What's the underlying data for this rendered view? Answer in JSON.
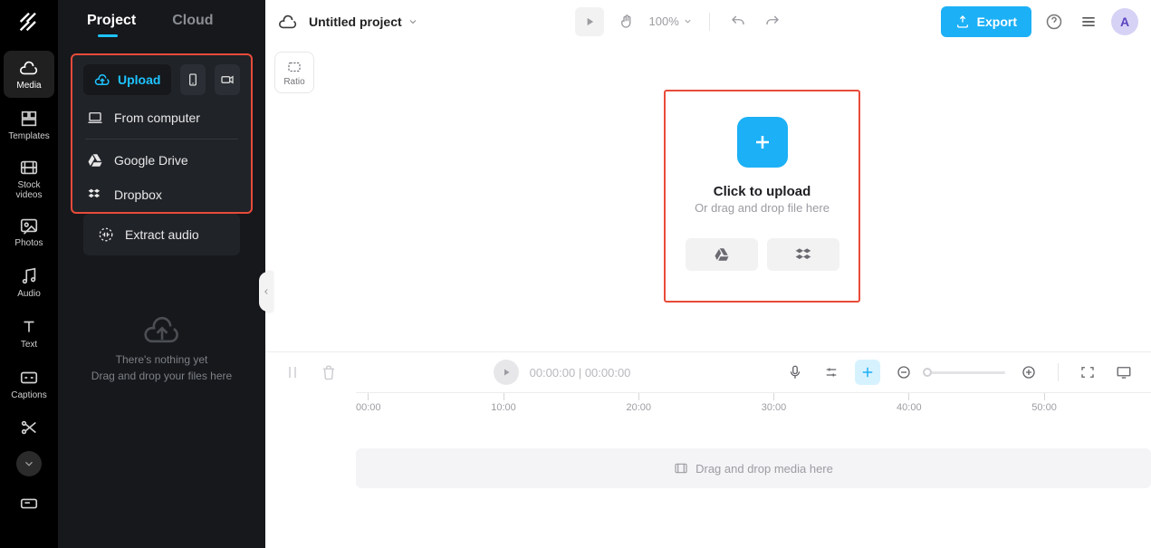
{
  "header": {
    "project_title": "Untitled project",
    "zoom": "100%",
    "export_label": "Export",
    "avatar_letter": "A"
  },
  "rail": {
    "items": [
      {
        "label": "Media"
      },
      {
        "label": "Templates"
      },
      {
        "label": "Stock videos"
      },
      {
        "label": "Photos"
      },
      {
        "label": "Audio"
      },
      {
        "label": "Text"
      },
      {
        "label": "Captions"
      }
    ]
  },
  "panel": {
    "tabs": {
      "project": "Project",
      "cloud": "Cloud"
    },
    "upload_label": "Upload",
    "menu": {
      "from_computer": "From computer",
      "google_drive": "Google Drive",
      "dropbox": "Dropbox",
      "extract_audio": "Extract audio"
    },
    "empty": {
      "line1": "There's nothing yet",
      "line2": "Drag and drop your files here"
    }
  },
  "stage": {
    "ratio_label": "Ratio",
    "upload_title": "Click to upload",
    "upload_sub": "Or drag and drop file here"
  },
  "timeline": {
    "time_current": "00:00:00",
    "time_total": "00:00:00",
    "ticks": [
      "00:00",
      "10:00",
      "20:00",
      "30:00",
      "40:00",
      "50:00"
    ],
    "drop_label": "Drag and drop media here"
  }
}
